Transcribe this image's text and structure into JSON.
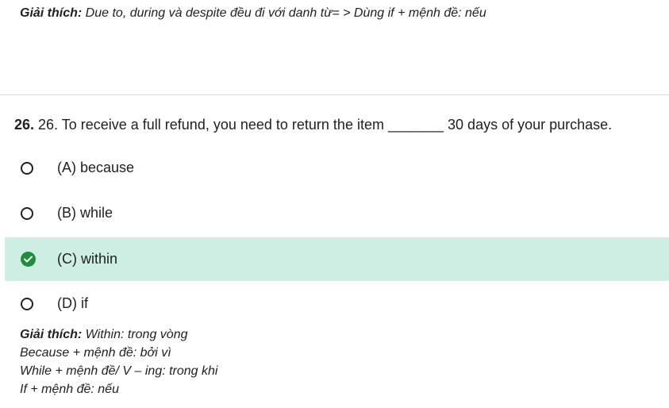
{
  "previous": {
    "explain_label": "Giải thích:",
    "explain_text": " Due to, during và despite đều đi với danh từ= > Dùng if + mệnh đề: nếu"
  },
  "question": {
    "number": "26.",
    "text": " 26. To receive a full refund, you need to return the item _______ 30 days of your purchase."
  },
  "options": [
    {
      "label": "(A) because",
      "selected": false
    },
    {
      "label": "(B) while",
      "selected": false
    },
    {
      "label": "(C) within",
      "selected": true
    },
    {
      "label": "(D) if",
      "selected": false
    }
  ],
  "explanation": {
    "label": "Giải thích:",
    "line1": " Within: trong vòng",
    "line2": "Because + mệnh đề: bởi vì",
    "line3": "While + mệnh đề/ V – ing: trong khi",
    "line4": "If + mệnh đề: nếu"
  },
  "colors": {
    "selected_bg": "#ceeee3",
    "check_green": "#1e8e3e",
    "divider": "#dadce0"
  },
  "icons": {
    "radio": "radio-empty-icon",
    "check": "check-circle-icon"
  }
}
